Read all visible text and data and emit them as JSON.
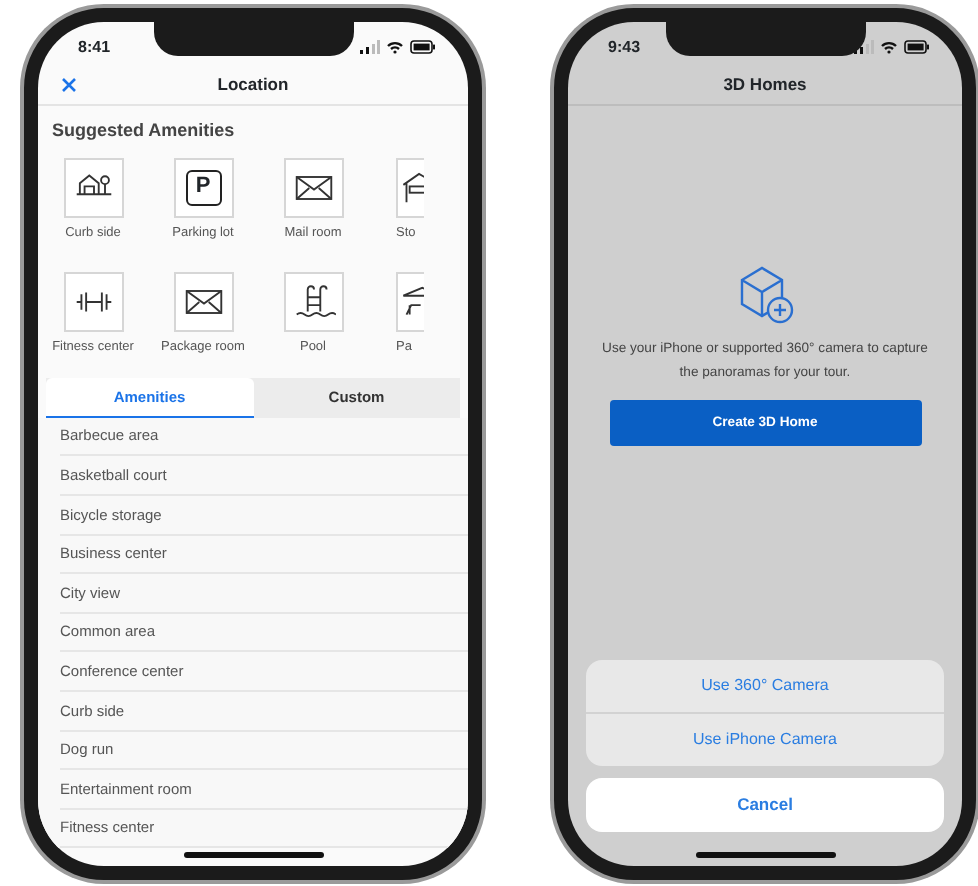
{
  "amenities_phone": {
    "status_time": "8:41",
    "title": "Location",
    "section_title": "Suggested Amenities",
    "tiles": [
      {
        "kind": "icon",
        "label": "Curb side"
      },
      {
        "kind": "glyph",
        "glyph": "P",
        "label": "Parking lot"
      },
      {
        "kind": "icon",
        "label": "Mail room"
      },
      {
        "kind": "icon",
        "label": "Sto"
      },
      {
        "kind": "icon",
        "label": "Fitness center"
      },
      {
        "kind": "icon",
        "label": "Package room"
      },
      {
        "kind": "icon",
        "label": "Pool"
      },
      {
        "kind": "icon",
        "label": "Pa"
      }
    ],
    "tabs": [
      {
        "label": "Amenities",
        "selected": true
      },
      {
        "label": "Custom",
        "selected": false
      }
    ],
    "items": [
      "Barbecue area",
      "Basketball court",
      "Bicycle storage",
      "Business center",
      "City view",
      "Common area",
      "Conference center",
      "Curb side",
      "Dog run",
      "Entertainment room",
      "Fitness center"
    ]
  },
  "homes_phone": {
    "status_time": "9:43",
    "title": "3D Homes",
    "message": "Use your iPhone or supported 360° camera to capture the panoramas for your tour.",
    "create_button": "Create 3D Home",
    "sheet_options": [
      "Use 360° Camera",
      "Use iPhone Camera"
    ],
    "cancel_button": "Cancel"
  }
}
